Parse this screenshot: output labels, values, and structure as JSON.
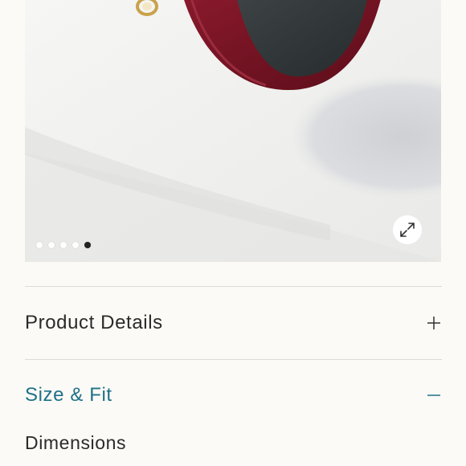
{
  "gallery": {
    "dot_count": 5,
    "active_index": 4,
    "expand_icon": "expand-arrows-icon"
  },
  "accordion": {
    "product_details": {
      "label": "Product Details",
      "state": "collapsed",
      "icon": "plus-icon"
    },
    "size_fit": {
      "label": "Size & Fit",
      "state": "expanded",
      "icon": "minus-icon",
      "dimensions_label": "Dimensions"
    }
  },
  "colors": {
    "accent": "#1f7188",
    "text": "#2a2a2a",
    "background": "#fbfaf6",
    "frame": "#6e1020"
  }
}
